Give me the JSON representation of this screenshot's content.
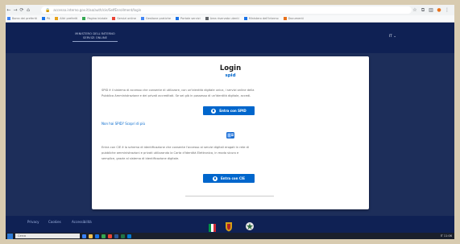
{
  "browser": {
    "url": "accesso.interno.gov.it/aa/auth/cie/SelfEnrollment/login",
    "nav_icons": [
      "back-icon",
      "forward-icon",
      "reload-icon",
      "home-icon"
    ],
    "bookmarks": [
      {
        "label": "Barra dei preferiti",
        "color": "#4285f4"
      },
      {
        "label": "PA",
        "color": "#1a73e8"
      },
      {
        "label": "Altri preferiti",
        "color": "#e8a21a"
      },
      {
        "label": "Pagina iniziale",
        "color": "#34a853"
      },
      {
        "label": "Servizi online",
        "color": "#ea4335"
      },
      {
        "label": "Gestione pratiche",
        "color": "#4285f4"
      },
      {
        "label": "Portale servizi",
        "color": "#1a73e8"
      },
      {
        "label": "Area riservata utenti",
        "color": "#5f6368"
      },
      {
        "label": "Ministero dell'Interno",
        "color": "#1a73e8"
      },
      {
        "label": "Documenti",
        "color": "#e8711a"
      }
    ]
  },
  "header": {
    "logo_line1": "MINISTERO DELL'INTERNO",
    "logo_line2": "SERVIZI ONLINE",
    "language": "IT ⌄"
  },
  "card": {
    "title": "Login",
    "subtitle": "spid",
    "spid_text_1": "SPID è il sistema di accesso che consente di utilizzare, con un'identità digitale unica, i servizi online della",
    "spid_text_2": "Pubblica Amministrazione e dei privati accreditati. Se sei già in possesso di un'identità digitale, accedi.",
    "spid_button": "Entra con SPID",
    "more_info_link": "Non hai SPID? Scopri di più",
    "cie_text_1": "Entra con CIE è lo schema di identificazione che consente l'accesso ai servizi digitali erogati in rete di",
    "cie_text_2": "pubbliche amministrazioni e privati utilizzando la Carta d'Identità Elettronica, in modo sicuro e",
    "cie_text_3": "semplice, grazie al sistema di identificazione digitale.",
    "cie_button": "Entra con CIE"
  },
  "footer": {
    "links": [
      "Privacy",
      "Cookies",
      "Accessibilità"
    ]
  },
  "taskbar": {
    "search_placeholder": "Cerca",
    "tray_text": "IT 11:06"
  },
  "colors": {
    "accent": "#0066cc",
    "header_bg": "#0f2154",
    "page_bg": "#1d2e5a"
  }
}
